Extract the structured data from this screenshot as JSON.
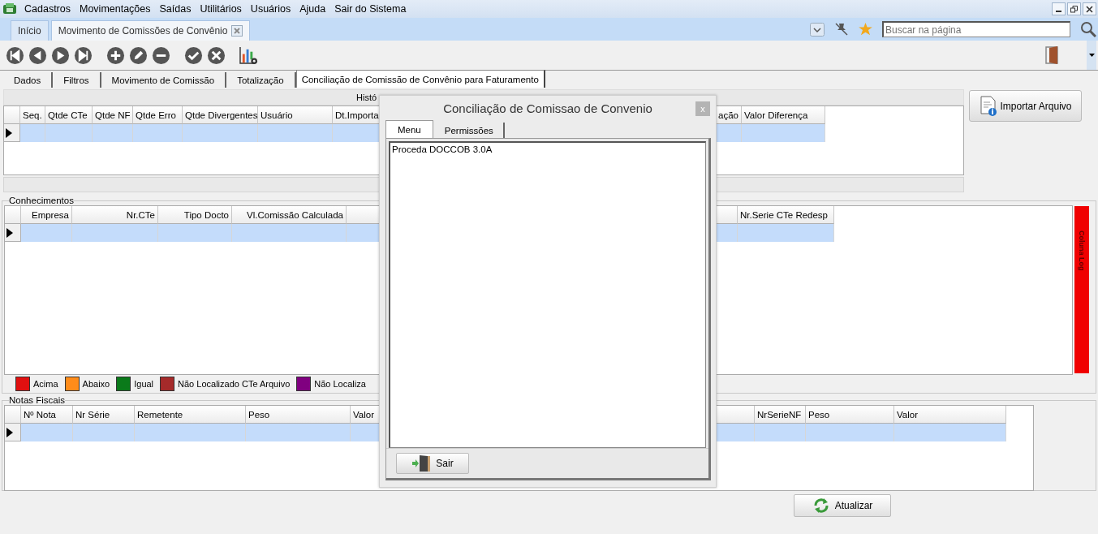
{
  "menu": [
    "Cadastros",
    "Movimentações",
    "Saídas",
    "Utilitários",
    "Usuários",
    "Ajuda",
    "Sair do Sistema"
  ],
  "window_tabs": [
    {
      "label": "Início",
      "selected": false
    },
    {
      "label": "Movimento de Comissões de Convênio",
      "selected": true
    }
  ],
  "search": {
    "placeholder": "Buscar na página"
  },
  "form_tabs": [
    {
      "label": "Dados",
      "selected": false
    },
    {
      "label": "Filtros",
      "selected": false
    },
    {
      "label": "Movimento de Comissão",
      "selected": false
    },
    {
      "label": "Totalização",
      "selected": false
    },
    {
      "label": "Conciliação de Comissão de Convênio para Faturamento",
      "selected": true
    }
  ],
  "history_panel": {
    "title": "Histó",
    "grid": {
      "columns": [
        "Seq.",
        "Qtde CTe",
        "Qtde NF",
        "Qtde Erro",
        "Qtde Divergentes",
        "Usuário",
        "Dt.Importa",
        "ação",
        "Valor Diferença"
      ],
      "rows": [
        {
          "selected": true
        }
      ]
    }
  },
  "import_button": {
    "label": "Importar Arquivo"
  },
  "conhecimentos": {
    "title": "Conhecimentos",
    "grid": {
      "columns": [
        "Empresa",
        "Nr.CTe",
        "Tipo Docto",
        "Vl.Comissão Calculada",
        "Nr.Serie CTe Redesp"
      ],
      "rows": [
        {
          "selected": true
        }
      ]
    },
    "legend": [
      {
        "label": "Acima",
        "color": "#e01010"
      },
      {
        "label": "Abaixo",
        "color": "#ff8c1a"
      },
      {
        "label": "Igual",
        "color": "#0a7a1a"
      },
      {
        "label": "Não Localizado CTe Arquivo",
        "color": "#a52a2a"
      },
      {
        "label": "Não Localiza",
        "color": "#800080"
      }
    ],
    "log_tab": {
      "label": "Coluna Log"
    }
  },
  "notas_fiscais": {
    "title": "Notas Fiscais",
    "grid": {
      "columns": [
        "Nº Nota",
        "Nr Série",
        "Remetente",
        "Peso",
        "Valor",
        "NrSerieNF",
        "Peso",
        "Valor"
      ],
      "rows": [
        {
          "selected": true
        }
      ]
    }
  },
  "refresh_button": {
    "label": "Atualizar"
  },
  "dialog": {
    "title": "Conciliação de Comissao de Convenio",
    "close_label": "x",
    "tabs": [
      {
        "label": "Menu",
        "selected": true
      },
      {
        "label": "Permissões",
        "selected": false
      }
    ],
    "items": [
      "Proceda DOCCOB 3.0A"
    ],
    "exit_button": {
      "label": "Sair"
    }
  }
}
